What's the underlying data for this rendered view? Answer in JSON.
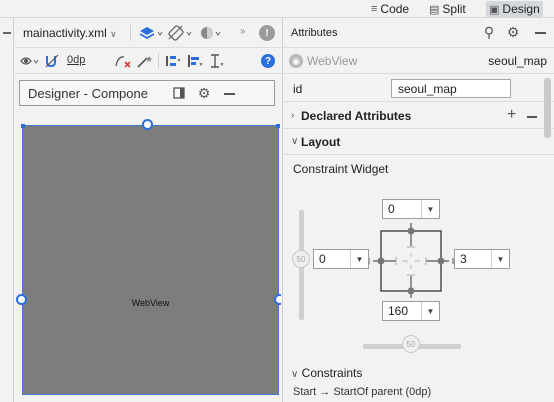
{
  "view_modes": {
    "code": "Code",
    "split": "Split",
    "design": "Design",
    "active": "design"
  },
  "designer": {
    "file_name": "mainactivity.xml",
    "toolbar2": {
      "margin_value": "0dp"
    },
    "panel_title": "Designer - Compone",
    "webview_label": "WebView"
  },
  "attributes": {
    "title": "Attributes",
    "component_type": "WebView",
    "component_id": "seoul_map",
    "id_label": "id",
    "id_value": "seoul_map",
    "declared_attributes": "Declared Attributes",
    "layout": "Layout",
    "constraint_widget": "Constraint Widget",
    "constraint_margins": {
      "top": "0",
      "left": "0",
      "right": "3",
      "bottom": "160"
    },
    "vertical_bias": "50",
    "horizontal_bias": "50",
    "constraints": "Constraints",
    "constraint_row_partial": "Start → StartOf parent (0dp)"
  },
  "colors": {
    "accent": "#2a6fdb",
    "canvas": "#7d7d7d",
    "panel_bg": "#f2f2f2"
  }
}
